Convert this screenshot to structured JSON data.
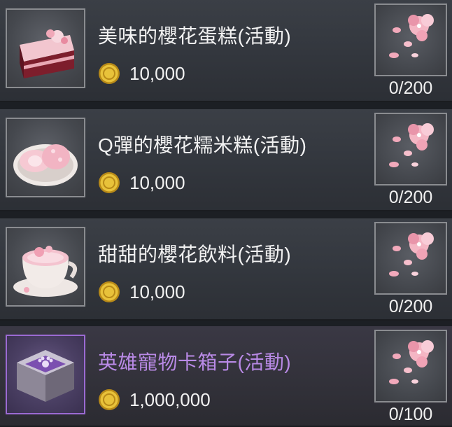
{
  "shop_items": [
    {
      "name": "美味的櫻花蛋糕(活動)",
      "price": "10,000",
      "item_icon": "sakura-cake-icon",
      "reward_icon": "sakura-petals-icon",
      "count": "0/200",
      "highlight": false
    },
    {
      "name": "Q彈的櫻花糯米糕(活動)",
      "price": "10,000",
      "item_icon": "sakura-mochi-icon",
      "reward_icon": "sakura-petals-icon",
      "count": "0/200",
      "highlight": false
    },
    {
      "name": "甜甜的櫻花飲料(活動)",
      "price": "10,000",
      "item_icon": "sakura-drink-icon",
      "reward_icon": "sakura-petals-icon",
      "count": "0/200",
      "highlight": false
    },
    {
      "name": "英雄寵物卡箱子(活動)",
      "price": "1,000,000",
      "item_icon": "pet-card-box-icon",
      "reward_icon": "sakura-petals-icon",
      "count": "0/100",
      "highlight": true
    }
  ],
  "colors": {
    "highlight_name": "#b98ae6",
    "normal_name": "#f2f2f2",
    "coin": "#e0b830"
  },
  "currency_icon": "gold-coin-icon"
}
